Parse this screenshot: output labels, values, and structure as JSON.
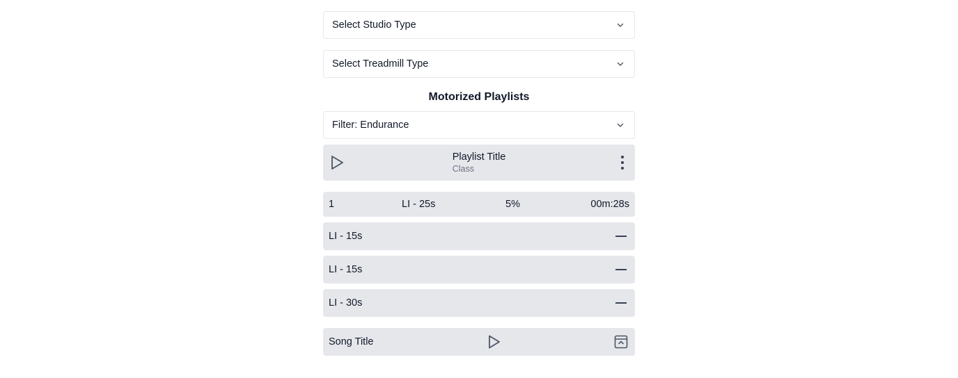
{
  "studio_select": {
    "label": "Select Studio Type",
    "icon": "chevron-down-icon"
  },
  "treadmill_select": {
    "label": "Select Treadmill Type",
    "icon": "chevron-down-icon"
  },
  "section": {
    "title": "Motorized Playlists"
  },
  "filter_select": {
    "label": "Filter: Endurance",
    "icon": "chevron-down-icon"
  },
  "playlist": {
    "title": "Playlist Title",
    "subtitle": "Class",
    "play_icon": "play-icon",
    "more_icon": "more-vertical-icon"
  },
  "current_interval": {
    "index": "1",
    "name": "LI - 25s",
    "incline": "5%",
    "time": "00m:28s"
  },
  "intervals": [
    {
      "label": "LI - 15s"
    },
    {
      "label": "LI - 15s"
    },
    {
      "label": "LI - 30s"
    }
  ],
  "song": {
    "title": "Song Title",
    "play_icon": "play-icon",
    "collapse_icon": "collapse-panel-icon"
  },
  "colors": {
    "card_bg": "#e5e7eb",
    "border": "#e5e7eb",
    "text": "#111827",
    "muted": "#6b7280",
    "icon": "#4b5563"
  }
}
